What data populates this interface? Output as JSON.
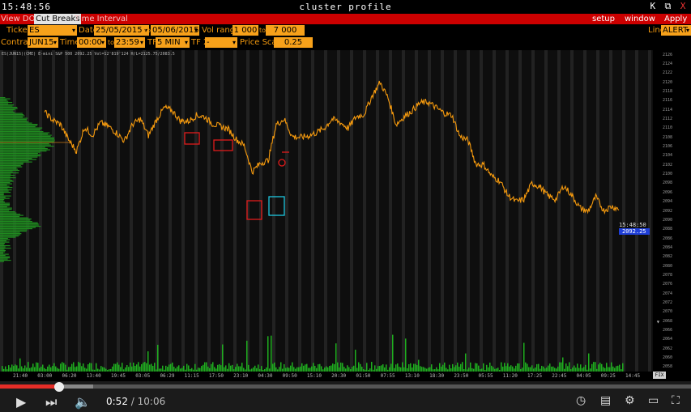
{
  "titlebar": {
    "clock": "15:48:56",
    "title": "cluster profile",
    "buttons": [
      "K",
      "⧉",
      "X"
    ]
  },
  "menu": {
    "items": [
      "View DOM",
      "Cut Breaks",
      "Time Interval"
    ],
    "active_index": 1,
    "right": [
      "setup",
      "window",
      "Apply"
    ]
  },
  "params_row1": {
    "ticker_label": "Ticker",
    "ticker": "ES",
    "date_label": "Date",
    "date_from": "25/05/2015",
    "date_to_label": "to",
    "date_to": "05/06/2015",
    "vol_label": "Vol range",
    "vol_from": "1 000",
    "vol_to_label": "to",
    "vol_to": "7 000",
    "line_label": "Line",
    "line_value": "ALERT"
  },
  "params_row2": {
    "contract_label": "Contract",
    "contract": "JUN15",
    "time_label": "Time",
    "time_from": "00:00",
    "time_to_label": "to",
    "time_to": "23:59",
    "tf_label": "TF",
    "tf": "5 MIN",
    "tf2_label": "TF 2",
    "tf2": "-",
    "price_scale_label": "Price Scale",
    "price_scale": "0.25"
  },
  "chart": {
    "info": "ES(JUN15)(CME) E-mini S&P 500  2092.25  Vol=12'819'124  H/L=2125.75/2083.5",
    "last_time": "15:48:50",
    "last_price": "2092.25",
    "colors": {
      "price": "#f59a0e",
      "volume": "#1fae1f",
      "profile": "#1f8a1f",
      "red_box": "#e01b1b",
      "cyan_box": "#1ec8e0",
      "price_tag_bg": "#1f3fd8"
    }
  },
  "chart_data": {
    "type": "line",
    "y_ticks": [
      "2126",
      "2124",
      "2122",
      "2120",
      "2118",
      "2116",
      "2114",
      "2112",
      "2110",
      "2108",
      "2106",
      "2104",
      "2102",
      "2100",
      "2098",
      "2096",
      "2094",
      "2092",
      "2090",
      "2088",
      "2086",
      "2084",
      "2082",
      "2080",
      "2078",
      "2076",
      "2074",
      "2072",
      "2070",
      "2068",
      "2066",
      "2064",
      "2062",
      "2060",
      "2058"
    ],
    "x_ticks": [
      "21:40",
      "03:00",
      "06:20",
      "13:40",
      "19:45",
      "03:05",
      "06:29",
      "11:15",
      "17:50",
      "23:10",
      "04:30",
      "09:50",
      "15:10",
      "20:30",
      "01:50",
      "07:55",
      "13:10",
      "18:30",
      "23:50",
      "05:55",
      "11:20",
      "17:25",
      "22:45",
      "04:05",
      "09:25",
      "14:45"
    ],
    "ylim": [
      2057,
      2127
    ],
    "price_series": [
      2113.5,
      2111.8,
      2110.8,
      2107.5,
      2105.0,
      2110.2,
      2108.5,
      2111.2,
      2110.4,
      2109.0,
      2107.2,
      2110.8,
      2112.0,
      2108.4,
      2111.8,
      2114.5,
      2113.8,
      2111.6,
      2111.5,
      2112.8,
      2112.5,
      2111.0,
      2110.4,
      2109.8,
      2107.6,
      2106.2,
      2100.5,
      2102.4,
      2103.0,
      2110.8,
      2112.0,
      2108.2,
      2108.0,
      2108.3,
      2109.0,
      2110.0,
      2112.0,
      2111.3,
      2110.0,
      2112.5,
      2113.0,
      2117.0,
      2120.0,
      2116.6,
      2110.8,
      2112.5,
      2113.8,
      2115.5,
      2115.7,
      2114.5,
      2113.3,
      2112.8,
      2108.2,
      2107.4,
      2102.2,
      2102.0,
      2099.5,
      2098.5,
      2095.4,
      2094.0,
      2094.5,
      2098.0,
      2097.3,
      2095.3,
      2094.5,
      2097.5,
      2095.4,
      2092.7,
      2091.8,
      2095.0,
      2092.1,
      2093.0,
      2092.3
    ]
  },
  "player": {
    "current": "0:52",
    "duration": "10:06",
    "progress": 0.086
  }
}
